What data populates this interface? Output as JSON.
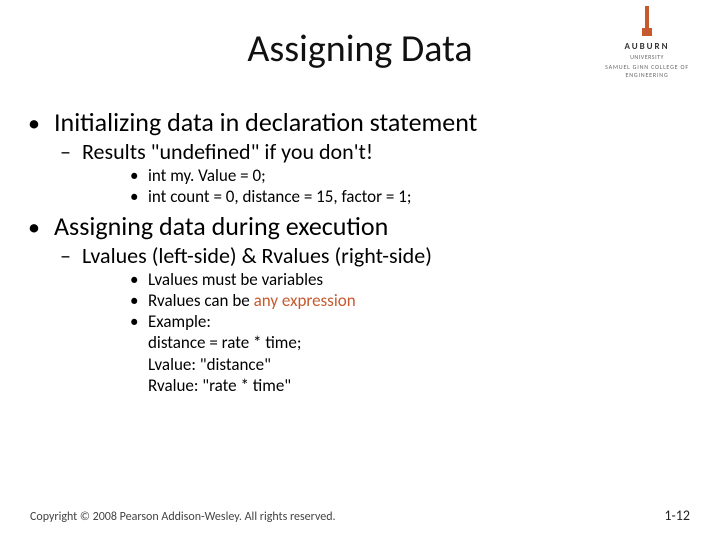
{
  "logo": {
    "name": "AUBURN",
    "sub1": "UNIVERSITY",
    "sub2": "SAMUEL GINN COLLEGE OF ENGINEERING"
  },
  "title": "Assigning Data",
  "bullets": {
    "b1": "Initializing data in declaration statement",
    "b1a": "Results \"undefined\" if you don't!",
    "b1a_i": "int my. Value = 0;",
    "b1a_ii": "int count = 0, distance = 15, factor = 1;",
    "b2": "Assigning data during execution",
    "b2a": "Lvalues (left-side) & Rvalues (right-side)",
    "b2a_i": "Lvalues must be variables",
    "b2a_ii_pre": "Rvalues can be ",
    "b2a_ii_accent": "any expression",
    "b2a_iii": "Example:",
    "b2a_iii_l1": "distance = rate * time;",
    "b2a_iii_l2": "Lvalue:  \"distance\"",
    "b2a_iii_l3": "Rvalue: \"rate * time\""
  },
  "footer": {
    "copyright": "Copyright © 2008 Pearson Addison-Wesley. All rights reserved.",
    "page": "1-12"
  }
}
